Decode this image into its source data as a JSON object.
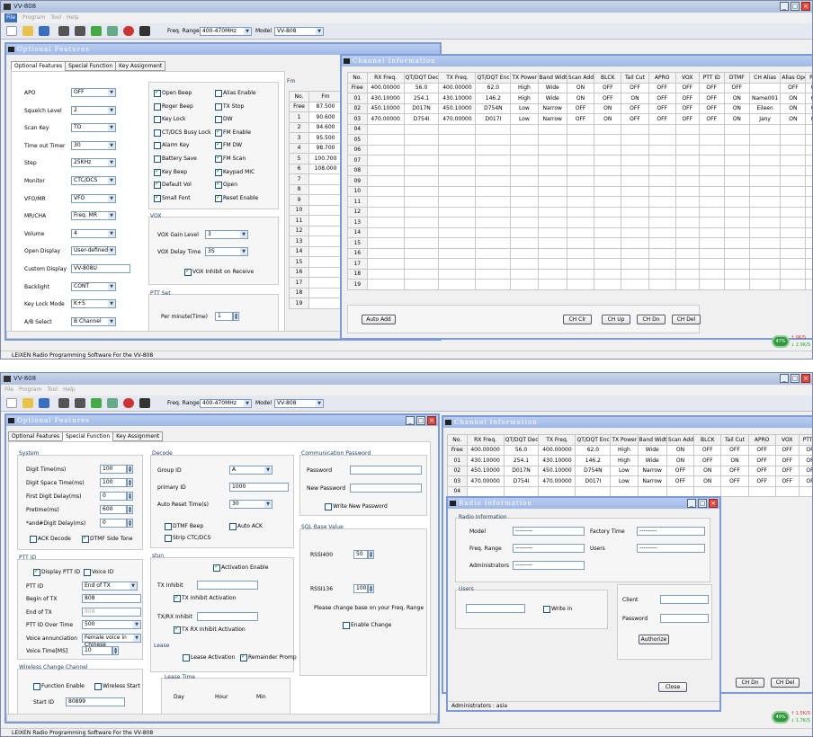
{
  "app": {
    "title": "VV-808",
    "menu": [
      "File",
      "Program",
      "Tool",
      "Help"
    ],
    "freq_range_label": "Freq. Range",
    "freq_range_value": "400-470MHz",
    "model_label": "Model",
    "model_value": "VV-808",
    "status": "LEIXEN Radio Programming Software For the VV-808"
  },
  "optional_features": {
    "title": "Optional Features",
    "tabs": [
      "Optional Features",
      "Special Function",
      "Key Assignment"
    ],
    "settings": [
      {
        "label": "APO",
        "value": "OFF"
      },
      {
        "label": "Squelch Level",
        "value": "2"
      },
      {
        "label": "Scan Key",
        "value": "TO"
      },
      {
        "label": "Time out Timer",
        "value": "30"
      },
      {
        "label": "Step",
        "value": "25KHz"
      },
      {
        "label": "Monitor",
        "value": "CTC/DCS"
      },
      {
        "label": "VFO/MR",
        "value": "VFO"
      },
      {
        "label": "MR/CHA",
        "value": "Freq. MR"
      },
      {
        "label": "Volume",
        "value": "4"
      },
      {
        "label": "Open Display",
        "value": "User-defined"
      },
      {
        "label": "Custom Display",
        "value": "VV-808U"
      },
      {
        "label": "Backlight",
        "value": "CONT"
      },
      {
        "label": "Key Lock Mode",
        "value": "K+S"
      },
      {
        "label": "A/B Select",
        "value": "B Channel"
      }
    ],
    "checks_left": [
      {
        "label": "Open Beep",
        "on": true
      },
      {
        "label": "Roger Beep",
        "on": false
      },
      {
        "label": "Key Lock",
        "on": false
      },
      {
        "label": "CT/DCS Busy Lock",
        "on": false
      },
      {
        "label": "Alarm Key",
        "on": false
      },
      {
        "label": "Battery Save",
        "on": false
      },
      {
        "label": "Key Beep",
        "on": true
      },
      {
        "label": "Default Vol",
        "on": true
      },
      {
        "label": "Small Font",
        "on": true
      }
    ],
    "checks_right": [
      {
        "label": "Alias Enable",
        "on": false
      },
      {
        "label": "TX Stop",
        "on": false
      },
      {
        "label": "DW",
        "on": false
      },
      {
        "label": "FM Enable",
        "on": true
      },
      {
        "label": "FM DW",
        "on": true
      },
      {
        "label": "FM Scan",
        "on": true
      },
      {
        "label": "Keypad MIC",
        "on": true
      },
      {
        "label": "Open",
        "on": true
      },
      {
        "label": "Reset Enable",
        "on": true
      }
    ],
    "vox": {
      "title": "VOX",
      "gain_label": "VOX Gain Level",
      "gain_value": "3",
      "delay_label": "VOX Delay Time",
      "delay_value": "3S",
      "inhibit_label": "VOX Inhibit on Receive"
    },
    "ptt_set": {
      "title": "PTT Set",
      "label": "Per minute(Time)",
      "value": "1"
    },
    "fm": {
      "title": "Fm",
      "headers": [
        "No.",
        "Fm"
      ],
      "rows": [
        [
          "Free",
          "87.500"
        ],
        [
          "1",
          "90.600"
        ],
        [
          "2",
          "94.600"
        ],
        [
          "3",
          "95.500"
        ],
        [
          "4",
          "98.700"
        ],
        [
          "5",
          "100.700"
        ],
        [
          "6",
          "108.000"
        ],
        [
          "7",
          ""
        ],
        [
          "8",
          ""
        ],
        [
          "9",
          ""
        ],
        [
          "10",
          ""
        ],
        [
          "11",
          ""
        ],
        [
          "12",
          ""
        ],
        [
          "13",
          ""
        ],
        [
          "14",
          ""
        ],
        [
          "15",
          ""
        ],
        [
          "16",
          ""
        ],
        [
          "17",
          ""
        ],
        [
          "18",
          ""
        ],
        [
          "19",
          ""
        ]
      ]
    }
  },
  "channel": {
    "title": "Channel Information",
    "headers": [
      "No.",
      "RX Freq.",
      "QT/DQT Dec",
      "TX Freq.",
      "QT/DQT Enc",
      "TX Power",
      "Band Width",
      "Scan Add",
      "BLCK",
      "Tail Cut",
      "APRO",
      "VOX",
      "PTT ID",
      "DTMF",
      "CH Alias",
      "Alias Open",
      "Rev"
    ],
    "rows": [
      [
        "Free",
        "400.00000",
        "56.0",
        "400.00000",
        "62.0",
        "High",
        "Wide",
        "ON",
        "OFF",
        "OFF",
        "OFF",
        "OFF",
        "OFF",
        "OFF",
        "",
        "OFF",
        "OF"
      ],
      [
        "01",
        "430.10000",
        "254.1",
        "430.10000",
        "146.2",
        "High",
        "Wide",
        "ON",
        "OFF",
        "ON",
        "OFF",
        "OFF",
        "OFF",
        "ON",
        "Name001",
        "ON",
        "OF"
      ],
      [
        "02",
        "450.10000",
        "D017N",
        "450.10000",
        "D754N",
        "Low",
        "Narrow",
        "OFF",
        "ON",
        "OFF",
        "OFF",
        "OFF",
        "OFF",
        "ON",
        "Eileen",
        "ON",
        "OF"
      ],
      [
        "03",
        "470.00000",
        "D754I",
        "470.00000",
        "D017I",
        "Low",
        "Narrow",
        "OFF",
        "ON",
        "OFF",
        "OFF",
        "OFF",
        "OFF",
        "ON",
        "Jany",
        "ON",
        "OF"
      ],
      [
        "04"
      ],
      [
        "05"
      ],
      [
        "06"
      ],
      [
        "07"
      ],
      [
        "08"
      ],
      [
        "09"
      ],
      [
        "10"
      ],
      [
        "11"
      ],
      [
        "12"
      ],
      [
        "13"
      ],
      [
        "14"
      ],
      [
        "15"
      ],
      [
        "16"
      ],
      [
        "17"
      ],
      [
        "18"
      ],
      [
        "19"
      ]
    ],
    "buttons": {
      "auto_add": "Auto Add",
      "ch_clr": "CH Clr",
      "ch_up": "CH Up",
      "ch_dn": "CH Dn",
      "ch_del": "CH Del"
    }
  },
  "net1": {
    "pct": "47%",
    "up": "0K/S",
    "down": "2.9K/S"
  },
  "net2": {
    "pct": "49%",
    "up": "1.5K/S",
    "down": "1.7K/S"
  },
  "special": {
    "system_title": "System",
    "system": [
      {
        "label": "Digit Time(ms)",
        "value": "100"
      },
      {
        "label": "Digit Space Time(ms)",
        "value": "100"
      },
      {
        "label": "First Digit Delay(ms)",
        "value": "0"
      },
      {
        "label": "Pretime(ms)",
        "value": "600"
      },
      {
        "label": "*and#Digit Delay(ms)",
        "value": "0"
      }
    ],
    "ack_decode": "ACK Decode",
    "dtmf_side_tone": "DTMF Side Tone",
    "ptt_title": "PTT ID",
    "display_ptt_id": "Display PTT ID",
    "voice_id": "Voice ID",
    "ptt": [
      {
        "label": "PTT ID",
        "value": "End of TX"
      },
      {
        "label": "Begin of TX",
        "value": "808"
      },
      {
        "label": "End of TX",
        "value": "808"
      },
      {
        "label": "PTT ID Over Time",
        "value": "500"
      },
      {
        "label": "Voice annunciation",
        "value": "Female voice in Chinese"
      },
      {
        "label": "Voice Time[MS]",
        "value": "10"
      }
    ],
    "wcc_title": "Wireless Change Channel",
    "function_enable": "Function Enable",
    "wireless_start": "Wireless Start",
    "start_id_label": "Start ID",
    "start_id_value": "80899",
    "decode_title": "Decode",
    "group_id_label": "Group ID",
    "group_id_value": "A",
    "primary_id_label": "primary ID",
    "primary_id_value": "1000",
    "auto_reset_label": "Auto Reset Time(s)",
    "auto_reset_value": "30",
    "dtmf_beep": "DTMF Beep",
    "auto_ack": "Auto ACK",
    "strip_ctc": "Strip CTC/DCS",
    "stun_title": "stun",
    "activation_enable": "Activation Enable",
    "tx_inhibit": "TX Inhibit",
    "tx_inhibit_activation": "TX Inhibit Activation",
    "txrx_inhibit": "TX/RX Inhibit",
    "txrx_inhibit_activation": "TX RX Inhibit Activation",
    "lease_title": "Lease",
    "lease_activation": "Lease Activation",
    "remainder_prompt": "Remainder Promp",
    "lease_time_title": "Lease Time",
    "day": "Day",
    "hour": "Hour",
    "min": "Min",
    "comm_title": "Communication Password",
    "password": "Password",
    "new_password": "New Password",
    "write_new_password": "Write New Password",
    "sql_title": "SQL Base Value",
    "rssi400_label": "RSSI400",
    "rssi400_value": "50",
    "rssi136_label": "RSSI136",
    "rssi136_value": "100",
    "note": "Please change base on your Freq. Range",
    "enable_change": "Enable Change"
  },
  "radio_info": {
    "title": "Radio Information",
    "section": "Radio Information",
    "model": "Model",
    "factory_time": "Factory Time",
    "freq_range": "Freq. Range",
    "users": "Users",
    "administrators": "Administrators",
    "placeholder": "---------",
    "users_section": "Users",
    "write_in": "Write in",
    "client": "Client",
    "password": "Password",
    "authorize": "Authorize",
    "close": "Close",
    "status": "Administrators : asia"
  }
}
